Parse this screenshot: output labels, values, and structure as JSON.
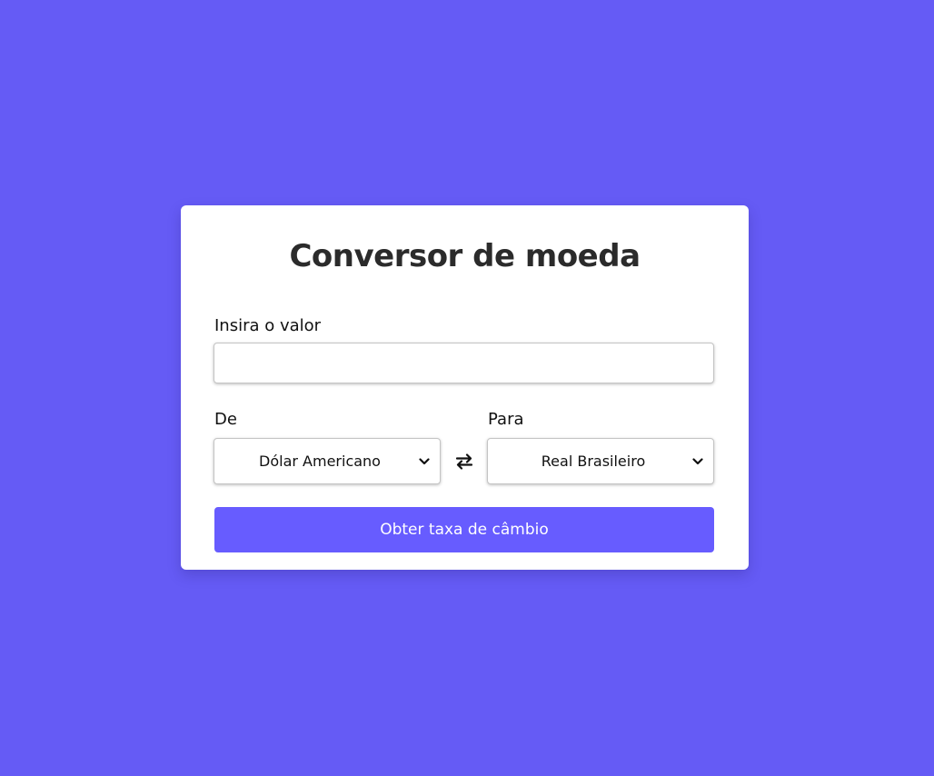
{
  "page": {
    "background_color": "#655bf5"
  },
  "card": {
    "title": "Conversor de moeda",
    "amount": {
      "label": "Insira o valor",
      "value": "",
      "placeholder": ""
    },
    "from": {
      "label": "De",
      "selected": "Dólar Americano"
    },
    "to": {
      "label": "Para",
      "selected": "Real Brasileiro"
    },
    "swap_icon": "swap-arrows-icon",
    "button": {
      "label": "Obter taxa de câmbio",
      "color": "#675cff"
    }
  }
}
